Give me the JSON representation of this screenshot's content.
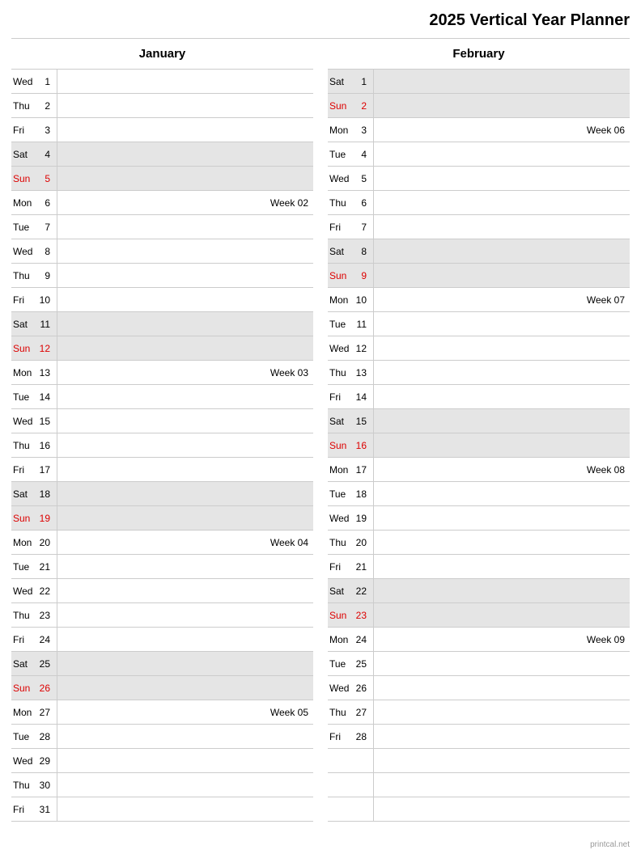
{
  "title": "2025 Vertical Year Planner",
  "footer": "printcal.net",
  "months": [
    {
      "name": "January",
      "days": [
        {
          "dow": "Wed",
          "num": "1",
          "weekend": false,
          "sunday": false,
          "note": ""
        },
        {
          "dow": "Thu",
          "num": "2",
          "weekend": false,
          "sunday": false,
          "note": ""
        },
        {
          "dow": "Fri",
          "num": "3",
          "weekend": false,
          "sunday": false,
          "note": ""
        },
        {
          "dow": "Sat",
          "num": "4",
          "weekend": true,
          "sunday": false,
          "note": ""
        },
        {
          "dow": "Sun",
          "num": "5",
          "weekend": true,
          "sunday": true,
          "note": ""
        },
        {
          "dow": "Mon",
          "num": "6",
          "weekend": false,
          "sunday": false,
          "note": "Week 02"
        },
        {
          "dow": "Tue",
          "num": "7",
          "weekend": false,
          "sunday": false,
          "note": ""
        },
        {
          "dow": "Wed",
          "num": "8",
          "weekend": false,
          "sunday": false,
          "note": ""
        },
        {
          "dow": "Thu",
          "num": "9",
          "weekend": false,
          "sunday": false,
          "note": ""
        },
        {
          "dow": "Fri",
          "num": "10",
          "weekend": false,
          "sunday": false,
          "note": ""
        },
        {
          "dow": "Sat",
          "num": "11",
          "weekend": true,
          "sunday": false,
          "note": ""
        },
        {
          "dow": "Sun",
          "num": "12",
          "weekend": true,
          "sunday": true,
          "note": ""
        },
        {
          "dow": "Mon",
          "num": "13",
          "weekend": false,
          "sunday": false,
          "note": "Week 03"
        },
        {
          "dow": "Tue",
          "num": "14",
          "weekend": false,
          "sunday": false,
          "note": ""
        },
        {
          "dow": "Wed",
          "num": "15",
          "weekend": false,
          "sunday": false,
          "note": ""
        },
        {
          "dow": "Thu",
          "num": "16",
          "weekend": false,
          "sunday": false,
          "note": ""
        },
        {
          "dow": "Fri",
          "num": "17",
          "weekend": false,
          "sunday": false,
          "note": ""
        },
        {
          "dow": "Sat",
          "num": "18",
          "weekend": true,
          "sunday": false,
          "note": ""
        },
        {
          "dow": "Sun",
          "num": "19",
          "weekend": true,
          "sunday": true,
          "note": ""
        },
        {
          "dow": "Mon",
          "num": "20",
          "weekend": false,
          "sunday": false,
          "note": "Week 04"
        },
        {
          "dow": "Tue",
          "num": "21",
          "weekend": false,
          "sunday": false,
          "note": ""
        },
        {
          "dow": "Wed",
          "num": "22",
          "weekend": false,
          "sunday": false,
          "note": ""
        },
        {
          "dow": "Thu",
          "num": "23",
          "weekend": false,
          "sunday": false,
          "note": ""
        },
        {
          "dow": "Fri",
          "num": "24",
          "weekend": false,
          "sunday": false,
          "note": ""
        },
        {
          "dow": "Sat",
          "num": "25",
          "weekend": true,
          "sunday": false,
          "note": ""
        },
        {
          "dow": "Sun",
          "num": "26",
          "weekend": true,
          "sunday": true,
          "note": ""
        },
        {
          "dow": "Mon",
          "num": "27",
          "weekend": false,
          "sunday": false,
          "note": "Week 05"
        },
        {
          "dow": "Tue",
          "num": "28",
          "weekend": false,
          "sunday": false,
          "note": ""
        },
        {
          "dow": "Wed",
          "num": "29",
          "weekend": false,
          "sunday": false,
          "note": ""
        },
        {
          "dow": "Thu",
          "num": "30",
          "weekend": false,
          "sunday": false,
          "note": ""
        },
        {
          "dow": "Fri",
          "num": "31",
          "weekend": false,
          "sunday": false,
          "note": ""
        }
      ],
      "empty_rows": 0
    },
    {
      "name": "February",
      "days": [
        {
          "dow": "Sat",
          "num": "1",
          "weekend": true,
          "sunday": false,
          "note": ""
        },
        {
          "dow": "Sun",
          "num": "2",
          "weekend": true,
          "sunday": true,
          "note": ""
        },
        {
          "dow": "Mon",
          "num": "3",
          "weekend": false,
          "sunday": false,
          "note": "Week 06"
        },
        {
          "dow": "Tue",
          "num": "4",
          "weekend": false,
          "sunday": false,
          "note": ""
        },
        {
          "dow": "Wed",
          "num": "5",
          "weekend": false,
          "sunday": false,
          "note": ""
        },
        {
          "dow": "Thu",
          "num": "6",
          "weekend": false,
          "sunday": false,
          "note": ""
        },
        {
          "dow": "Fri",
          "num": "7",
          "weekend": false,
          "sunday": false,
          "note": ""
        },
        {
          "dow": "Sat",
          "num": "8",
          "weekend": true,
          "sunday": false,
          "note": ""
        },
        {
          "dow": "Sun",
          "num": "9",
          "weekend": true,
          "sunday": true,
          "note": ""
        },
        {
          "dow": "Mon",
          "num": "10",
          "weekend": false,
          "sunday": false,
          "note": "Week 07"
        },
        {
          "dow": "Tue",
          "num": "11",
          "weekend": false,
          "sunday": false,
          "note": ""
        },
        {
          "dow": "Wed",
          "num": "12",
          "weekend": false,
          "sunday": false,
          "note": ""
        },
        {
          "dow": "Thu",
          "num": "13",
          "weekend": false,
          "sunday": false,
          "note": ""
        },
        {
          "dow": "Fri",
          "num": "14",
          "weekend": false,
          "sunday": false,
          "note": ""
        },
        {
          "dow": "Sat",
          "num": "15",
          "weekend": true,
          "sunday": false,
          "note": ""
        },
        {
          "dow": "Sun",
          "num": "16",
          "weekend": true,
          "sunday": true,
          "note": ""
        },
        {
          "dow": "Mon",
          "num": "17",
          "weekend": false,
          "sunday": false,
          "note": "Week 08"
        },
        {
          "dow": "Tue",
          "num": "18",
          "weekend": false,
          "sunday": false,
          "note": ""
        },
        {
          "dow": "Wed",
          "num": "19",
          "weekend": false,
          "sunday": false,
          "note": ""
        },
        {
          "dow": "Thu",
          "num": "20",
          "weekend": false,
          "sunday": false,
          "note": ""
        },
        {
          "dow": "Fri",
          "num": "21",
          "weekend": false,
          "sunday": false,
          "note": ""
        },
        {
          "dow": "Sat",
          "num": "22",
          "weekend": true,
          "sunday": false,
          "note": ""
        },
        {
          "dow": "Sun",
          "num": "23",
          "weekend": true,
          "sunday": true,
          "note": ""
        },
        {
          "dow": "Mon",
          "num": "24",
          "weekend": false,
          "sunday": false,
          "note": "Week 09"
        },
        {
          "dow": "Tue",
          "num": "25",
          "weekend": false,
          "sunday": false,
          "note": ""
        },
        {
          "dow": "Wed",
          "num": "26",
          "weekend": false,
          "sunday": false,
          "note": ""
        },
        {
          "dow": "Thu",
          "num": "27",
          "weekend": false,
          "sunday": false,
          "note": ""
        },
        {
          "dow": "Fri",
          "num": "28",
          "weekend": false,
          "sunday": false,
          "note": ""
        }
      ],
      "empty_rows": 3
    }
  ]
}
